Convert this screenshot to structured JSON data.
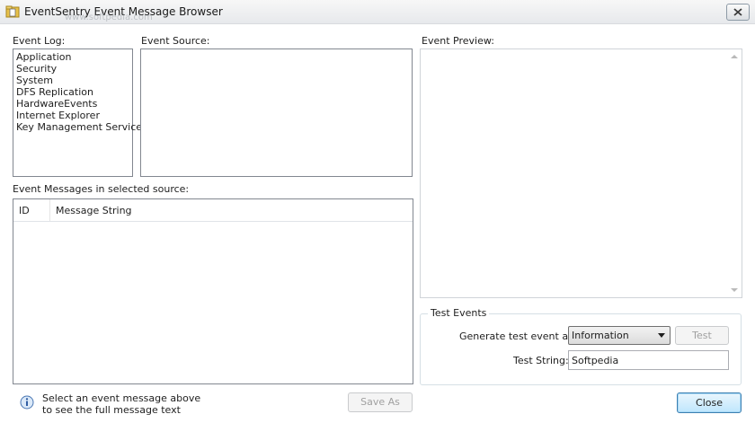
{
  "window": {
    "title": "EventSentry Event Message Browser",
    "watermark": "www.softpedia.com",
    "close_icon": "close-icon",
    "app_icon": "folder-icon"
  },
  "event_log": {
    "label": "Event Log:",
    "items": [
      "Application",
      "Security",
      "System",
      "DFS Replication",
      "HardwareEvents",
      "Internet Explorer",
      "Key Management Service"
    ]
  },
  "event_source": {
    "label": "Event Source:"
  },
  "event_preview": {
    "label": "Event Preview:"
  },
  "messages": {
    "label": "Event Messages in selected source:",
    "columns": [
      "ID",
      "Message String"
    ]
  },
  "test_events": {
    "group_title": "Test Events",
    "generate_label": "Generate test event as:",
    "generate_value": "Information",
    "test_button": "Test",
    "string_label": "Test String:",
    "string_value": "Softpedia"
  },
  "footer": {
    "hint_line1": "Select an event message above",
    "hint_line2": "to see the full message text",
    "info_icon": "info-icon",
    "save_as": "Save As",
    "close": "Close"
  },
  "colors": {
    "border": "#828790",
    "default_button": "#3c7fb1",
    "disabled_text": "#a0a0a0"
  }
}
